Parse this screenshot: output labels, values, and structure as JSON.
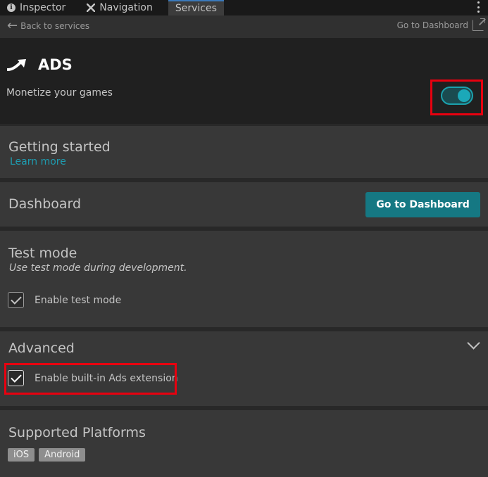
{
  "tabs": [
    {
      "label": "Inspector",
      "icon": "info-icon"
    },
    {
      "label": "Navigation",
      "icon": "navigation-icon"
    },
    {
      "label": "Services",
      "icon": null,
      "active": true
    }
  ],
  "topbar": {
    "back_label": "Back to services",
    "dashboard_link": "Go to Dashboard"
  },
  "service": {
    "name": "ADS",
    "subtitle": "Monetize your games",
    "enabled": true
  },
  "getting_started": {
    "title": "Getting started",
    "link": "Learn more"
  },
  "dashboard": {
    "title": "Dashboard",
    "button": "Go to Dashboard"
  },
  "test_mode": {
    "title": "Test mode",
    "subtitle": "Use test mode during development.",
    "checkbox_label": "Enable test mode",
    "checked": true
  },
  "advanced": {
    "title": "Advanced",
    "checkbox_label": "Enable built-in Ads extension",
    "checked": true
  },
  "platforms": {
    "title": "Supported Platforms",
    "items": [
      "iOS",
      "Android"
    ]
  },
  "colors": {
    "accent": "#157883",
    "toggle": "#1ba8b8",
    "link": "#1e9cb0",
    "highlight": "#e8000f"
  }
}
